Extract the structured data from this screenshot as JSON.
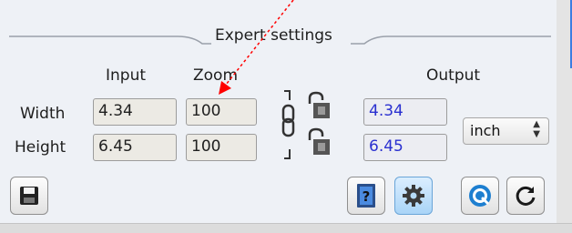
{
  "group": {
    "title": "Expert settings"
  },
  "columns": {
    "input": "Input",
    "zoom": "Zoom",
    "output": "Output"
  },
  "rows": [
    {
      "label": "Width",
      "input": "4.34",
      "zoom": "100",
      "output": "4.34"
    },
    {
      "label": "Height",
      "input": "6.45",
      "zoom": "100",
      "output": "6.45"
    }
  ],
  "unit": {
    "selected": "inch",
    "arrows": "▲▼"
  },
  "buttons": [
    {
      "icon": "save-icon"
    },
    {
      "icon": "help-icon"
    },
    {
      "icon": "gear-icon",
      "active": true
    },
    {
      "icon": "q-icon"
    },
    {
      "icon": "refresh-icon"
    }
  ],
  "colors": {
    "output_text": "#2a30d0",
    "annotation_arrow": "#ff0000",
    "active_button": "#a9d4f7"
  }
}
